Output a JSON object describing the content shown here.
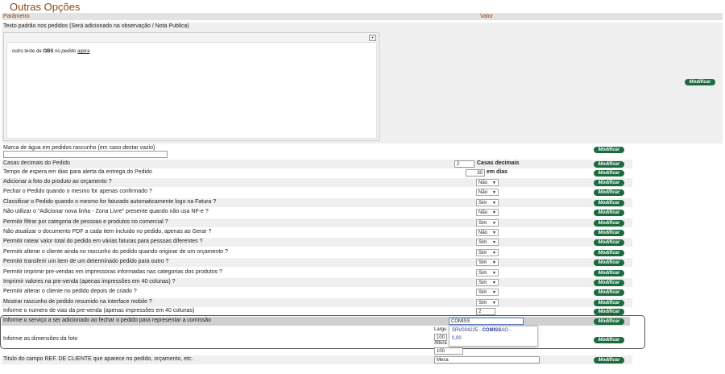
{
  "page_title": "Outras Opções",
  "header": {
    "param": "Parâmetro",
    "value": "Valor"
  },
  "button_label": "Modificar",
  "editor": {
    "label": "Texto padrão nos pedidos (Será adicionado na observação / Nota Publica)",
    "content": {
      "pre": "outro teste de ",
      "bold": "OBS",
      "mid": " no ",
      "italic": "pedido",
      "sp": " ",
      "underline": "agora"
    }
  },
  "watermark": {
    "label": "Marca de água em pedidos rascunho (em caso destar vazio)",
    "value": ""
  },
  "decimals": {
    "label": "Casas decimais do Pedido",
    "value": "2",
    "unit": "Casas decimais"
  },
  "wait": {
    "label": "Tempo de espera em dias para alerta da entrega do Pedido",
    "value": "30",
    "unit": "em dias"
  },
  "select_rows": [
    {
      "label": "Adicionar a foto do produto ao orçamento ?",
      "value": "Não"
    },
    {
      "label": "Fechar o Pedido quando o mesmo for apenas confirmado ?",
      "value": "Não"
    },
    {
      "label": "Classificar o Pedido quando o mesmo for faturado automaticamente logo na Fatura ?",
      "value": "Sim"
    },
    {
      "label": "Não utilizar o \"Adicionar nova linha - Zona Livre\" presente quando não usa NF-e ?",
      "value": "Não"
    },
    {
      "label": "Permitir filtrar por categoria de pessoas e produtos no comercial ?",
      "value": "Sim"
    },
    {
      "label": "Não atualizar o documento PDF a cada item incluido no pedido, apenas ao Gerar ?",
      "value": "Não"
    },
    {
      "label": "Permitir ratear valor total do pedido em várias faturas para pessoas diferentes ?",
      "value": "Sim"
    },
    {
      "label": "Permitir alterar o cliente ainda no rascunho do pedido quando originar de um orçamento ?",
      "value": "Sim"
    },
    {
      "label": "Permitir transferir um item de um determinado pedido para outro ?",
      "value": "Sim"
    },
    {
      "label": "Permitir imprimir pre-vendas em impressoras informadas nas categorias dos produtos ?",
      "value": "Sim"
    },
    {
      "label": "Imprimir valores na pre-venda (apenas impressões em 40 colunas) ?",
      "value": "Sim"
    },
    {
      "label": "Permitir alterar o cliente no pedido depois de criado ?",
      "value": "Sim"
    },
    {
      "label": "Mostrar rascunho de pedido resumido na interface mobile ?",
      "value": "Sim"
    }
  ],
  "vias": {
    "label": "Informe o numero de vias da pre-venda (apenas impressões em 40 colunas)",
    "value": "2"
  },
  "service": {
    "label": "Informe o serviço a ser adicionado ao fechar o pedido para representar a comissão",
    "value": "COMISS"
  },
  "autocomplete": {
    "line1_pre": "SRV004225 - ",
    "line1_bold": "COMISS",
    "line1_post": "AO -",
    "line2": "0,00"
  },
  "photo": {
    "label": "Informe as dimensões da foto",
    "width_label": "Largu",
    "width_value": "100",
    "height_label": "Altura",
    "height_value": "100"
  },
  "ref": {
    "label": "Titulo do campo REF. DE CLIENTE que aparece no pedido, orçamento, etc.",
    "value": "Mesa"
  },
  "arrow_glyph": "▼",
  "colors": {
    "button": "#1b6b3e",
    "title": "#8a4a1a",
    "header_bg": "#e2e2e2",
    "row_alt": "#efefef",
    "suggest": "#2a3c9a"
  }
}
